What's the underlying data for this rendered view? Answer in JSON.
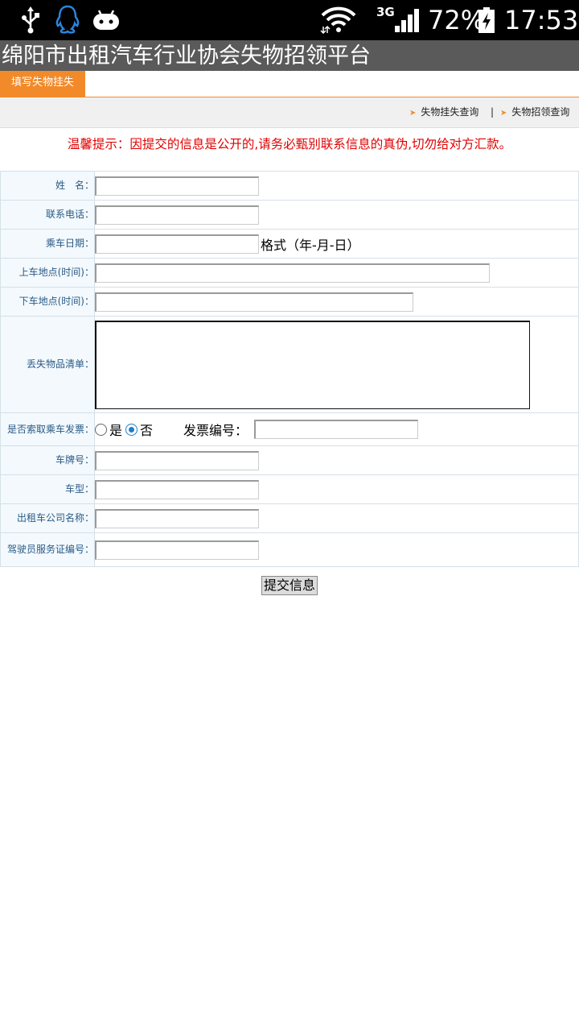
{
  "status_bar": {
    "network_type": "3G",
    "battery_percent": "72%",
    "time": "17:53",
    "icons": [
      "usb-icon",
      "qq-icon",
      "android-icon",
      "wifi-icon",
      "signal-icon",
      "battery-charging-icon"
    ]
  },
  "header": {
    "title": "绵阳市出租汽车行业协会失物招领平台"
  },
  "tabs": [
    {
      "label": "填写失物挂失",
      "active": true
    }
  ],
  "links": [
    {
      "label": "失物挂失查询"
    },
    {
      "label": "失物招领查询"
    }
  ],
  "link_separator": "|",
  "notice": "温馨提示：因提交的信息是公开的,请务必甄别联系信息的真伪,切勿给对方汇款。",
  "form": {
    "name_label": "姓　名：",
    "phone_label": "联系电话：",
    "date_label": "乘车日期：",
    "date_hint": "格式（年-月-日）",
    "pickup_label": "上车地点(时间)：",
    "dropoff_label": "下车地点(时间)：",
    "items_label": "丢失物品清单：",
    "invoice_question_label": "是否索取乘车发票：",
    "invoice_yes": "是",
    "invoice_no": "否",
    "invoice_selected": "否",
    "invoice_number_label": "发票编号：",
    "plate_label": "车牌号：",
    "car_type_label": "车型：",
    "company_label": "出租车公司名称：",
    "driver_license_label": "驾驶员服务证编号：",
    "submit_label": "提交信息"
  },
  "colors": {
    "accent_orange": "#f28a2a",
    "title_bar": "#5a5a5a",
    "notice_red": "#e00000",
    "label_bg": "#f3f9fd",
    "label_text": "#2a5a86",
    "radio_checked": "#1e7fc6"
  }
}
